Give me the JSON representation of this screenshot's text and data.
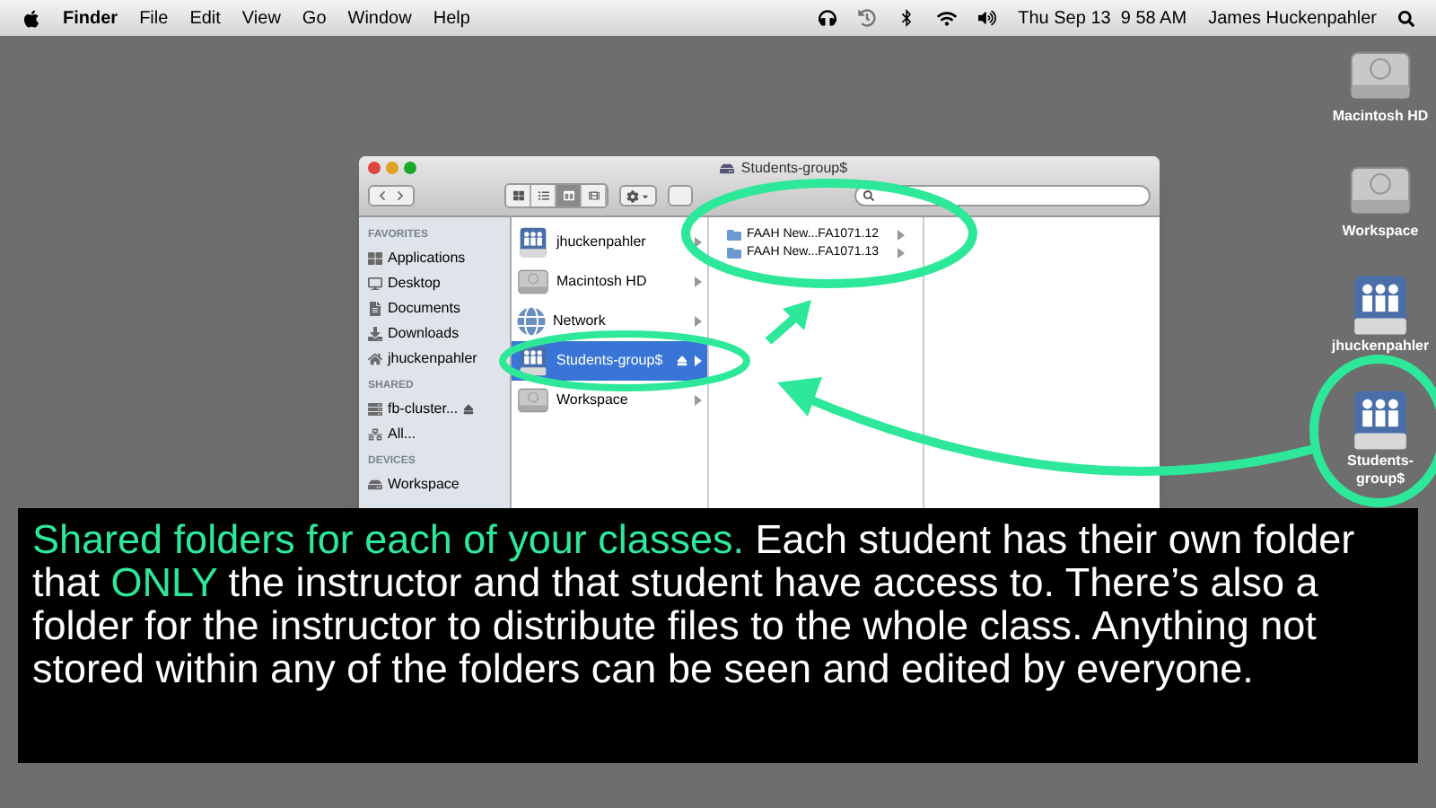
{
  "menu_bar": {
    "app": "Finder",
    "menus": [
      "File",
      "Edit",
      "View",
      "Go",
      "Window",
      "Help"
    ],
    "clock": "Thu Sep 13  9 58 AM",
    "user": "James Huckenpahler"
  },
  "finder": {
    "title": "Students-group$",
    "view_buttons": [
      {
        "kind": "icons",
        "selected": false
      },
      {
        "kind": "list",
        "selected": false
      },
      {
        "kind": "columns",
        "selected": true
      },
      {
        "kind": "coverflow",
        "selected": false
      }
    ],
    "sidebar": [
      {
        "heading": "FAVORITES",
        "items": [
          {
            "label": "Applications",
            "kind": "apps"
          },
          {
            "label": "Desktop",
            "kind": "desktop"
          },
          {
            "label": "Documents",
            "kind": "docs"
          },
          {
            "label": "Downloads",
            "kind": "download"
          },
          {
            "label": "jhuckenpahler",
            "kind": "home"
          }
        ]
      },
      {
        "heading": "SHARED",
        "items": [
          {
            "label": "fb-cluster...",
            "kind": "server",
            "eject": true
          },
          {
            "label": "All...",
            "kind": "network"
          }
        ]
      },
      {
        "heading": "DEVICES",
        "items": [
          {
            "label": "Workspace",
            "kind": "disk"
          }
        ]
      }
    ],
    "column_1": [
      {
        "label": "jhuckenpahler",
        "kind": "share",
        "selected": false,
        "eject": false
      },
      {
        "label": "Macintosh HD",
        "kind": "disk",
        "selected": false,
        "eject": false
      },
      {
        "label": "Network",
        "kind": "globe",
        "selected": false,
        "eject": false
      },
      {
        "label": "Students-group$",
        "kind": "share",
        "selected": true,
        "eject": true
      },
      {
        "label": "Workspace",
        "kind": "disk",
        "selected": false,
        "eject": false
      }
    ],
    "column_2": [
      {
        "label": "FAAH New...FA1071.12"
      },
      {
        "label": "FAAH New...FA1071.13"
      }
    ]
  },
  "desktop_icons": [
    {
      "label": "Macintosh HD",
      "kind": "disk"
    },
    {
      "label": "Workspace",
      "kind": "disk"
    },
    {
      "label": "jhuckenpahler",
      "kind": "share"
    },
    {
      "label": "Students-\ngroup$",
      "kind": "share"
    }
  ],
  "caption": [
    {
      "text": "Shared folders for each of your classes.",
      "highlight": true
    },
    {
      "text": " Each student has their own folder that ",
      "highlight": false
    },
    {
      "text": "ONLY",
      "highlight": true
    },
    {
      "text": " the instructor and that student have access to. There’s also a folder for the instructor to distribute files to the whole class. Anything not stored within any of the folders can be seen and edited by everyone.",
      "highlight": false
    }
  ]
}
